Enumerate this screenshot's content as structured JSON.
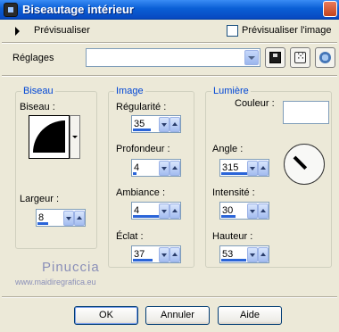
{
  "window": {
    "title": "Biseautage intérieur"
  },
  "preview": {
    "label": "Prévisualiser",
    "checkbox_label": "Prévisualiser l'image"
  },
  "settings": {
    "label": "Réglages",
    "combo_value": ""
  },
  "bevel_group": {
    "title": "Biseau",
    "bevel_label": "Biseau :",
    "width_label": "Largeur :",
    "width_value": "8"
  },
  "image_group": {
    "title": "Image",
    "regularity_label": "Régularité :",
    "regularity_value": "35",
    "depth_label": "Profondeur :",
    "depth_value": "4",
    "ambience_label": "Ambiance :",
    "ambience_value": "4",
    "shine_label": "Éclat :",
    "shine_value": "37"
  },
  "light_group": {
    "title": "Lumière",
    "color_label": "Couleur :",
    "color_value": "#ffffff",
    "angle_label": "Angle :",
    "angle_value": "315",
    "intensity_label": "Intensité :",
    "intensity_value": "30",
    "height_label": "Hauteur :",
    "height_value": "53"
  },
  "watermark": {
    "name": "Pinuccia",
    "url": "www.maidiregrafica.eu"
  },
  "buttons": {
    "ok": "OK",
    "cancel": "Annuler",
    "help": "Aide"
  }
}
